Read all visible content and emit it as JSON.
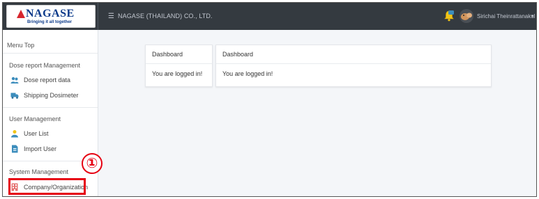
{
  "brand": {
    "logo_name": "NAGASE",
    "logo_tagline": "Bringing it all together"
  },
  "header": {
    "menu_icon": "hamburger-icon",
    "company_name": "NAGASE (THAILAND) CO., LTD.",
    "notification_icon": "bell-icon",
    "user_name": "Sirichai Theinrattanakul",
    "caret": "▾"
  },
  "sidebar": {
    "menu_top": "Menu Top",
    "sections": [
      {
        "title": "Dose report Management",
        "items": [
          {
            "label": "Dose report data",
            "icon": "people-icon"
          },
          {
            "label": "Shipping Dosimeter",
            "icon": "truck-icon"
          }
        ]
      },
      {
        "title": "User Management",
        "items": [
          {
            "label": "User List",
            "icon": "user-icon"
          },
          {
            "label": "Import User",
            "icon": "file-import-icon"
          }
        ]
      },
      {
        "title": "System Management",
        "items": [
          {
            "label": "Company/Organization",
            "icon": "building-icon"
          }
        ]
      }
    ]
  },
  "annotation": {
    "step_number": "①",
    "color": "#e60012"
  },
  "cards": [
    {
      "title": "Dashboard",
      "body": "You are logged in!"
    },
    {
      "title": "Dashboard",
      "body": "You are logged in!"
    }
  ],
  "colors": {
    "topbar": "#343a40",
    "content_bg": "#f4f6f9",
    "accent_blue": "#3c8dbc",
    "logo_red": "#d7272e",
    "logo_blue": "#0b3a8a"
  }
}
